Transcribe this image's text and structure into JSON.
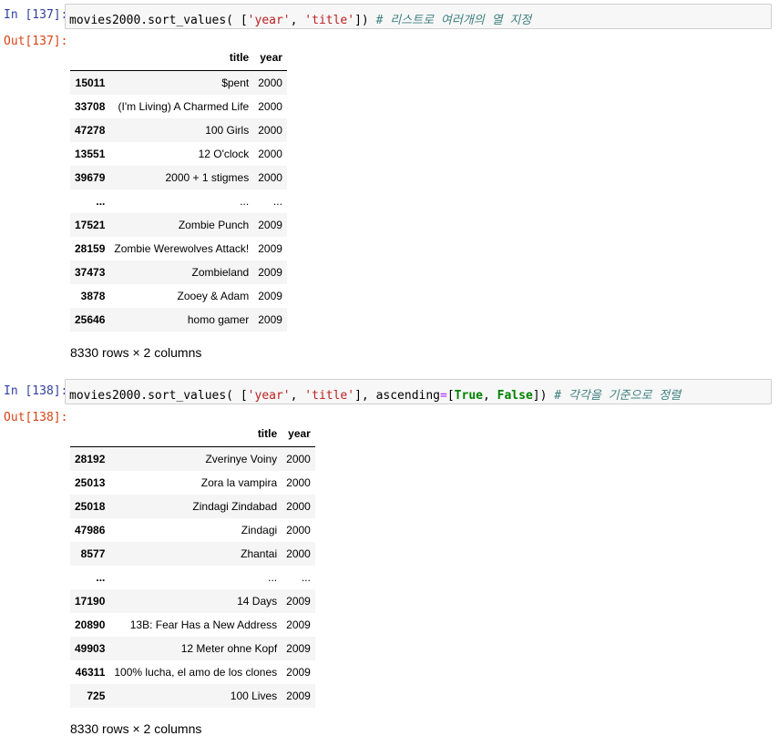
{
  "cells": [
    {
      "in_prompt": "In [137]:",
      "out_prompt": "Out[137]:",
      "code": {
        "p1": "movies2000.sort_values( [",
        "s1": "'year'",
        "p2": ", ",
        "s2": "'title'",
        "p3": "]) ",
        "comment": "# 리스트로 여러개의 열 지정"
      },
      "table": {
        "columns": [
          "title",
          "year"
        ],
        "rows": [
          {
            "index": "15011",
            "title": "$pent",
            "year": "2000"
          },
          {
            "index": "33708",
            "title": "(I'm Living) A Charmed Life",
            "year": "2000"
          },
          {
            "index": "47278",
            "title": "100 Girls",
            "year": "2000"
          },
          {
            "index": "13551",
            "title": "12 O'clock",
            "year": "2000"
          },
          {
            "index": "39679",
            "title": "2000 + 1 stigmes",
            "year": "2000"
          },
          {
            "index": "...",
            "title": "...",
            "year": "..."
          },
          {
            "index": "17521",
            "title": "Zombie Punch",
            "year": "2009"
          },
          {
            "index": "28159",
            "title": "Zombie Werewolves Attack!",
            "year": "2009"
          },
          {
            "index": "37473",
            "title": "Zombieland",
            "year": "2009"
          },
          {
            "index": "3878",
            "title": "Zooey & Adam",
            "year": "2009"
          },
          {
            "index": "25646",
            "title": "homo gamer",
            "year": "2009"
          }
        ]
      },
      "rows_note": "8330 rows × 2 columns"
    },
    {
      "in_prompt": "In [138]:",
      "out_prompt": "Out[138]:",
      "code": {
        "p1": "movies2000.sort_values( [",
        "s1": "'year'",
        "p2": ", ",
        "s2": "'title'",
        "p3": "], ascending",
        "op": "=",
        "p4": "[",
        "kw1": "True",
        "p5": ", ",
        "kw2": "False",
        "p6": "]) ",
        "comment": "# 각각을 기준으로 정렬"
      },
      "table": {
        "columns": [
          "title",
          "year"
        ],
        "rows": [
          {
            "index": "28192",
            "title": "Zverinye Voiny",
            "year": "2000"
          },
          {
            "index": "25013",
            "title": "Zora la vampira",
            "year": "2000"
          },
          {
            "index": "25018",
            "title": "Zindagi Zindabad",
            "year": "2000"
          },
          {
            "index": "47986",
            "title": "Zindagi",
            "year": "2000"
          },
          {
            "index": "8577",
            "title": "Zhantai",
            "year": "2000"
          },
          {
            "index": "...",
            "title": "...",
            "year": "..."
          },
          {
            "index": "17190",
            "title": "14 Days",
            "year": "2009"
          },
          {
            "index": "20890",
            "title": "13B: Fear Has a New Address",
            "year": "2009"
          },
          {
            "index": "49903",
            "title": "12 Meter ohne Kopf",
            "year": "2009"
          },
          {
            "index": "46311",
            "title": "100% lucha, el amo de los clones",
            "year": "2009"
          },
          {
            "index": "725",
            "title": "100 Lives",
            "year": "2009"
          }
        ]
      },
      "rows_note": "8330 rows × 2 columns"
    }
  ]
}
